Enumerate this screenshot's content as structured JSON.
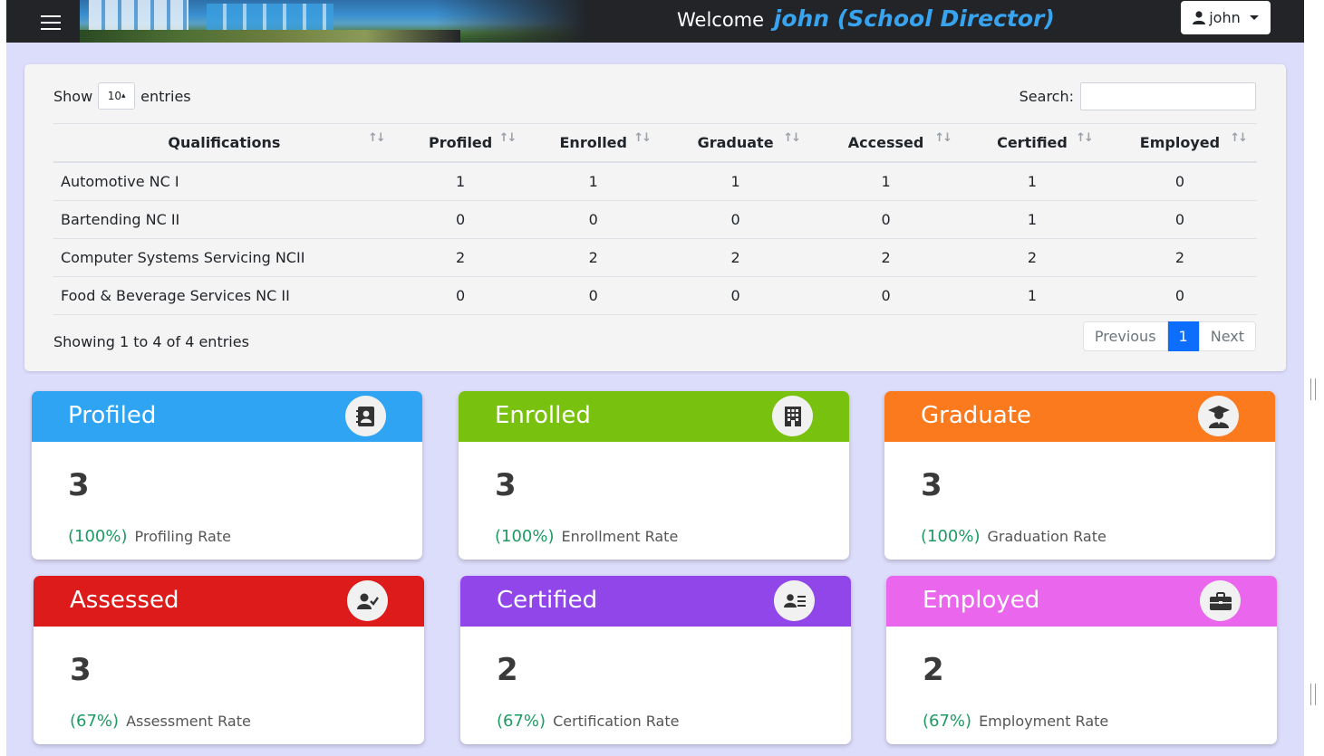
{
  "header": {
    "welcome_label": "Welcome",
    "user_display": "john (School Director)",
    "user_button_label": "john"
  },
  "table": {
    "show_label": "Show",
    "entries_value": "10",
    "entries_label": "entries",
    "search_label": "Search:",
    "search_value": "",
    "columns": [
      "Qualifications",
      "Profiled",
      "Enrolled",
      "Graduate",
      "Accessed",
      "Certified",
      "Employed"
    ],
    "rows": [
      [
        "Automotive NC I",
        "1",
        "1",
        "1",
        "1",
        "1",
        "0"
      ],
      [
        "Bartending NC II",
        "0",
        "0",
        "0",
        "0",
        "1",
        "0"
      ],
      [
        "Computer Systems Servicing NCII",
        "2",
        "2",
        "2",
        "2",
        "2",
        "2"
      ],
      [
        "Food & Beverage Services NC II",
        "0",
        "0",
        "0",
        "0",
        "1",
        "0"
      ]
    ],
    "info": "Showing 1 to 4 of 4 entries",
    "pagination": {
      "previous": "Previous",
      "page": "1",
      "next": "Next"
    }
  },
  "cards": [
    {
      "title": "Profiled",
      "value": "3",
      "pct": "(100%)",
      "rate_label": "Profiling Rate",
      "color": "#2ea4f2",
      "icon": "contact-book-icon"
    },
    {
      "title": "Enrolled",
      "value": "3",
      "pct": "(100%)",
      "rate_label": "Enrollment Rate",
      "color": "#78c10f",
      "icon": "building-icon"
    },
    {
      "title": "Graduate",
      "value": "3",
      "pct": "(100%)",
      "rate_label": "Graduation Rate",
      "color": "#fb7a1e",
      "icon": "graduate-icon"
    },
    {
      "title": "Assessed",
      "value": "3",
      "pct": "(67%)",
      "rate_label": "Assessment Rate",
      "color": "#dd1b1b",
      "icon": "user-check-icon"
    },
    {
      "title": "Certified",
      "value": "2",
      "pct": "(67%)",
      "rate_label": "Certification Rate",
      "color": "#9146ea",
      "icon": "id-card-icon"
    },
    {
      "title": "Employed",
      "value": "2",
      "pct": "(67%)",
      "rate_label": "Employment Rate",
      "color": "#ea66ed",
      "icon": "briefcase-icon"
    }
  ]
}
